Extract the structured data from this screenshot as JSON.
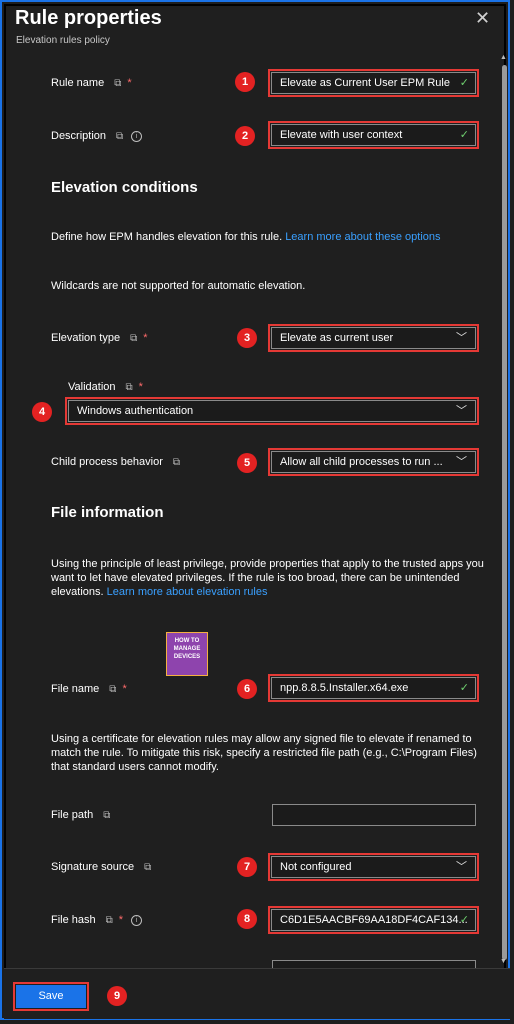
{
  "header": {
    "title": "Rule properties",
    "subtitle": "Elevation rules policy",
    "close_icon": "close-icon"
  },
  "form": {
    "rule_name": {
      "label": "Rule name",
      "value": "Elevate as Current User EPM Rule",
      "required": "*"
    },
    "description": {
      "label": "Description",
      "value": "Elevate with user context"
    },
    "elevation_conditions": {
      "heading": "Elevation conditions",
      "intro": "Define how EPM handles elevation for this rule.",
      "intro_link": "Learn more about these options",
      "wildcards_note": "Wildcards are not supported for automatic elevation.",
      "elevation_type": {
        "label": "Elevation type",
        "value": "Elevate as current user",
        "required": "*"
      },
      "validation": {
        "label": "Validation",
        "value": "Windows authentication",
        "required": "*"
      },
      "child_process": {
        "label": "Child process behavior",
        "value": "Allow all child processes to run ..."
      }
    },
    "file_information": {
      "heading": "File information",
      "intro": "Using the principle of least privilege, provide properties that apply to the trusted apps you want to let have elevated privileges. If the rule is too broad, there can be unintended elevations.",
      "intro_link": "Learn more about elevation rules",
      "logo_text": "HOW TO MANAGE DEVICES",
      "file_name": {
        "label": "File name",
        "value": "npp.8.8.5.Installer.x64.exe",
        "required": "*"
      },
      "cert_note": "Using a certificate for elevation rules may allow any signed file to elevate if renamed to match the rule. To mitigate this risk, specify a restricted file path (e.g., C:\\Program Files) that standard users cannot modify.",
      "file_path": {
        "label": "File path",
        "value": ""
      },
      "signature_source": {
        "label": "Signature source",
        "value": "Not configured"
      },
      "file_hash": {
        "label": "File hash",
        "value": "C6D1E5AACBF69AA18DF4CAF134...",
        "required": "*"
      }
    }
  },
  "footer": {
    "save_label": "Save"
  },
  "badges": [
    "1",
    "2",
    "3",
    "4",
    "5",
    "6",
    "7",
    "8",
    "9"
  ],
  "colors": {
    "accent": "#1a73e8",
    "highlight": "#e53935",
    "link": "#3aa0ff",
    "valid": "#6fcf6f",
    "background": "#1f1f1f"
  }
}
